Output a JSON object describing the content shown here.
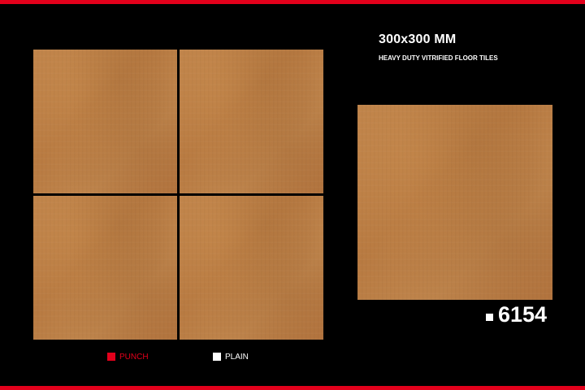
{
  "header": {
    "size": "300x300 MM",
    "description": "HEAVY DUTY VITRIFIED FLOOR TILES"
  },
  "product": {
    "code": "6154"
  },
  "legend": [
    {
      "label": "PUNCH",
      "color": "#e3001b"
    },
    {
      "label": "PLAIN",
      "color": "#ffffff"
    }
  ],
  "colors": {
    "accent_bar": "#e3001b",
    "background": "#000000",
    "tile_base": "#bc7f47"
  }
}
